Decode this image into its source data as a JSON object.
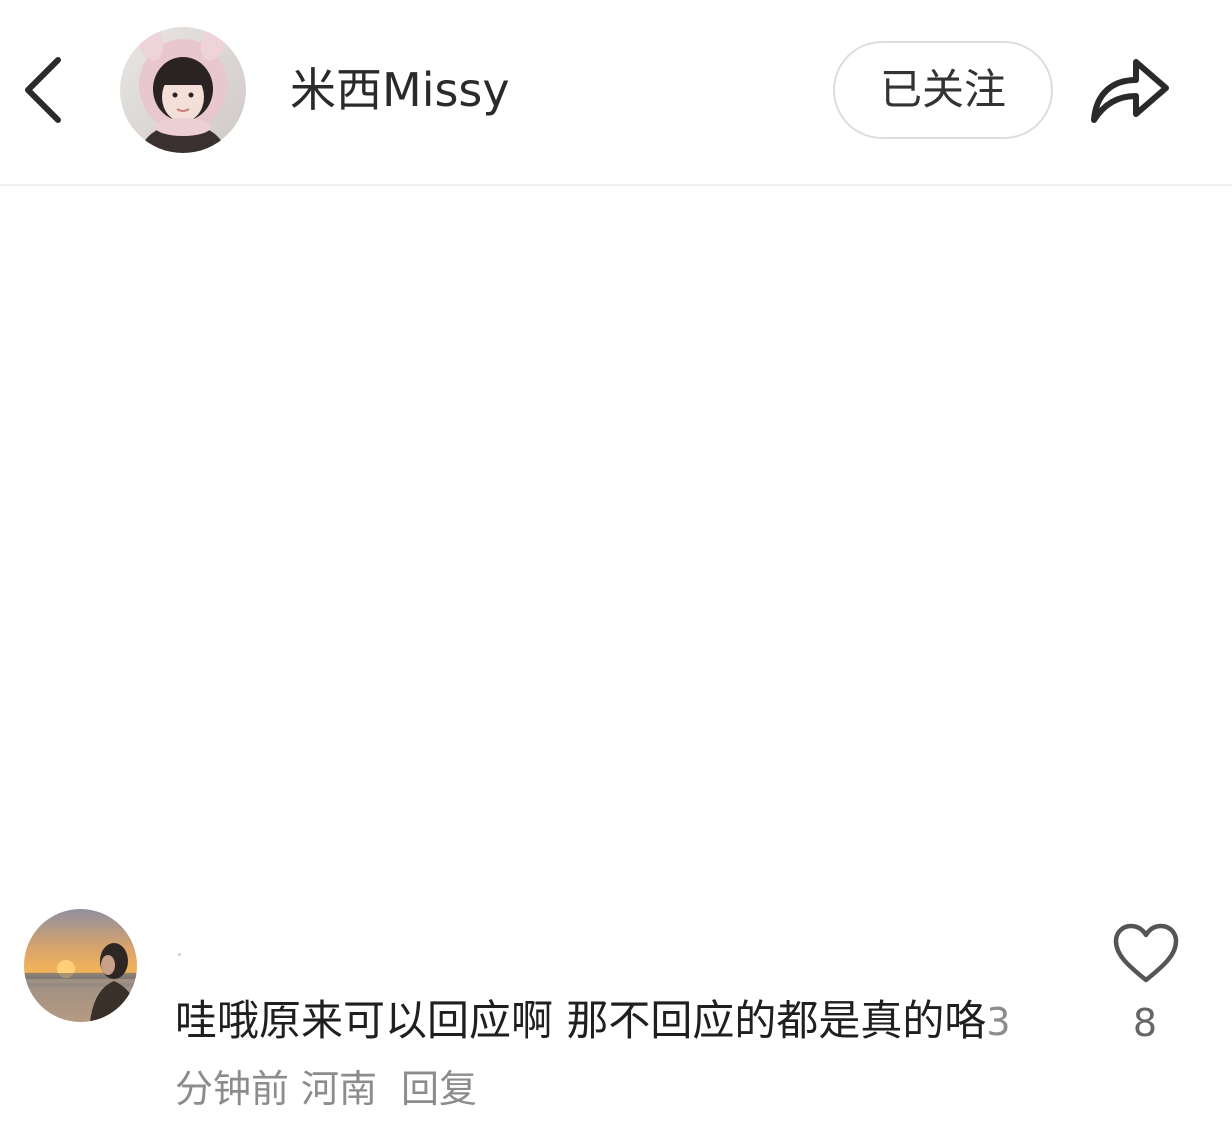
{
  "header": {
    "author_name": "米西Missy",
    "follow_label": "已关注",
    "back_icon": "chevron-left-icon",
    "share_icon": "share-arrow-icon"
  },
  "comment": {
    "text": "哇哦原来可以回应啊 那不回应的都是真的咯",
    "time": "3分钟前",
    "location": "河南",
    "reply_label": "回复",
    "like_count": "8",
    "like_icon": "heart-outline-icon"
  },
  "colors": {
    "text_primary": "#222222",
    "text_meta": "#8c8c8c",
    "divider": "#eeeeee",
    "button_border": "#dddddd"
  }
}
